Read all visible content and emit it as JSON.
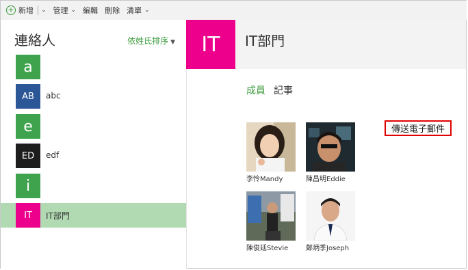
{
  "toolbar": {
    "new_label": "新增",
    "manage_label": "管理",
    "edit_label": "編輯",
    "delete_label": "刪除",
    "list_label": "清單"
  },
  "left": {
    "title": "連絡人",
    "sort_label": "依姓氏排序",
    "items": [
      {
        "tile": "a",
        "name": "",
        "color": "#3fa34d"
      },
      {
        "tile": "AB",
        "name": "abc",
        "color": "#2b5797"
      },
      {
        "tile": "e",
        "name": "",
        "color": "#3fa34d"
      },
      {
        "tile": "ED",
        "name": "edf",
        "color": "#1d1d1d"
      },
      {
        "tile": "i",
        "name": "",
        "color": "#3fa34d"
      },
      {
        "tile": "IT",
        "name": "IT部門",
        "color": "#ec008c"
      }
    ]
  },
  "group": {
    "tile": "IT",
    "title": "IT部門",
    "tabs": [
      "成員",
      "記事"
    ],
    "send_email": "傳送電子郵件",
    "members": [
      "李怜Mandy",
      "陳昌明Eddie",
      "陳俊廷Stevie",
      "鄭炳季Joseph"
    ]
  },
  "colors": {
    "accent": "#3a9a3a",
    "selected_row": "#b1dab3",
    "group_tile": "#ec008c",
    "highlight_box": "#e00000"
  }
}
